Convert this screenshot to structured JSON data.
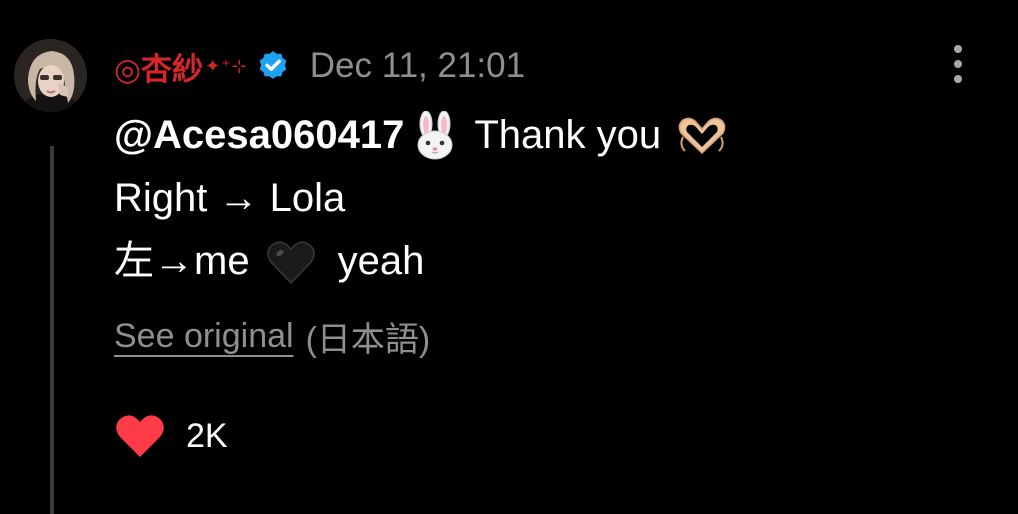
{
  "comment": {
    "avatar_icon": "user-avatar-photo",
    "username": "◎杏紗",
    "username_decoration": "✦⁺⊹",
    "verified_icon": "verified-badge-icon",
    "timestamp": "Dec 11, 21:01",
    "more_icon": "more-options-icon",
    "lines": [
      {
        "mention": "@Acesa060417",
        "emoji_1": "rabbit-face-emoji",
        "text": "Thank you",
        "emoji_2": "heart-hands-emoji"
      },
      {
        "text": "Right → Lola"
      },
      {
        "text_before": "左→me",
        "emoji": "black-heart-emoji",
        "text_after": "yeah"
      }
    ],
    "see_original": {
      "link_label": "See original",
      "language": "(日本語)"
    },
    "likes": {
      "icon": "heart-icon",
      "count": "2K"
    }
  },
  "colors": {
    "background": "#000000",
    "username": "#d6252b",
    "verified": "#1da1f2",
    "secondary_text": "#8e8e93",
    "like_heart": "#ff3b47",
    "thread_line": "#3a3a3c"
  }
}
